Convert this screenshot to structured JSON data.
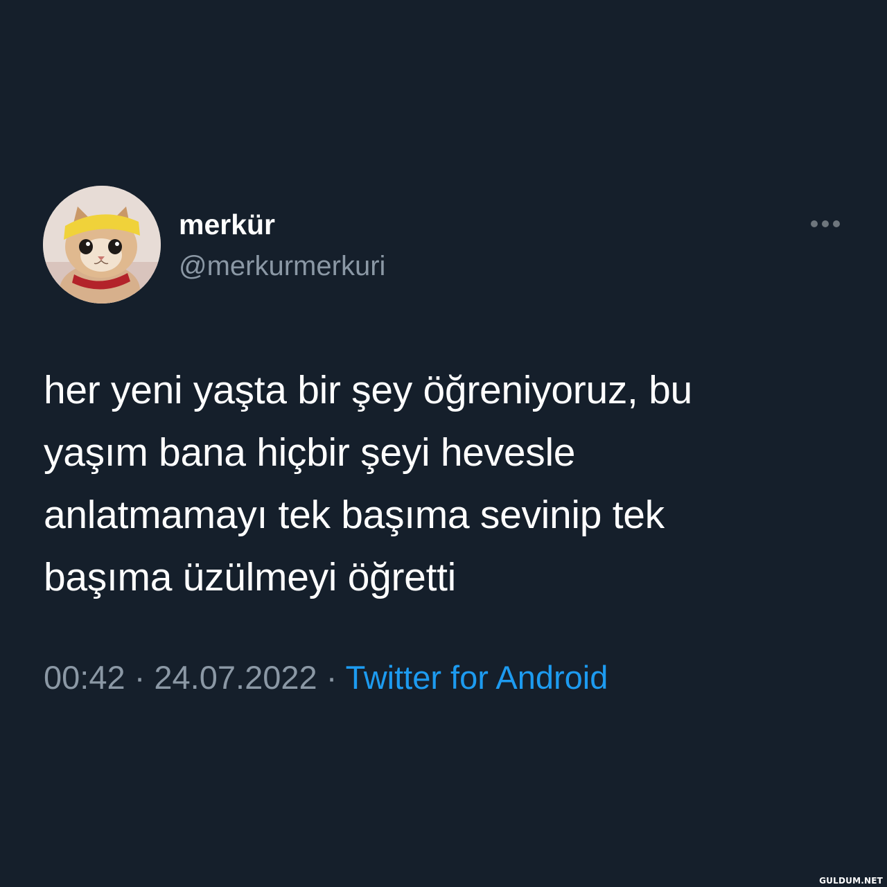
{
  "tweet": {
    "display_name": "merkür",
    "handle": "@merkurmerkuri",
    "text_lines": [
      "her yeni yaşta bir şey öğreniyoruz, bu",
      "yaşım bana hiçbir şeyi hevesle",
      "anlatmamayı tek başıma sevinip tek",
      "başıma üzülmeyi öğretti"
    ],
    "time": "00:42",
    "separator": "·",
    "date": "24.07.2022",
    "source": "Twitter for Android",
    "avatar_icon": "kitten-avatar",
    "more_icon": "more-horizontal-icon"
  },
  "watermark": "GULDUM.NET",
  "colors": {
    "background": "#151f2b",
    "text_primary": "#ffffff",
    "text_secondary": "#8b98a5",
    "link": "#1d9bf0"
  }
}
